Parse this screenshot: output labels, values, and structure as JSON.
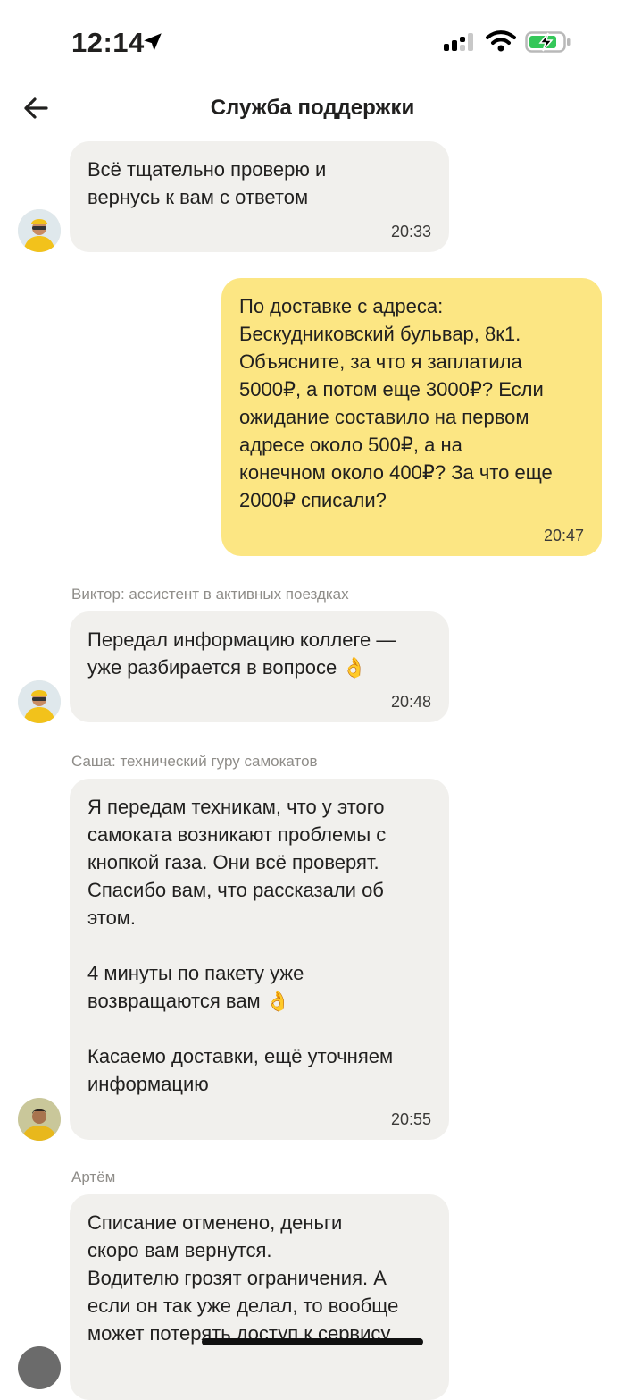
{
  "status_bar": {
    "time": "12:14"
  },
  "header": {
    "title": "Служба поддержки"
  },
  "messages": [
    {
      "text": "Всё тщательно проверю и\nвернусь к вам с ответом",
      "time": "20:33"
    },
    {
      "text": "По доставке с адреса:\nБескудниковский бульвар, 8к1.\nОбъясните, за что я заплатила\n5000₽, а потом еще 3000₽? Если\nожидание составило на первом\nадресе около 500₽, а на\nконечном около 400₽? За что еще\n2000₽ списали?",
      "time": "20:47"
    },
    {
      "sender": "Виктор: ассистент в активных поездках",
      "text": "Передал информацию коллеге —\nуже разбирается в вопросе 👌",
      "time": "20:48"
    },
    {
      "sender": "Саша: технический гуру самокатов",
      "text": "Я передам техникам, что у этого\nсамоката возникают проблемы с\nкнопкой газа. Они всё проверят.\nСпасибо вам, что рассказали об\nэтом.\n\n4 минуты по пакету уже\nвозвращаются вам 👌\n\nКасаемо доставки, ещё уточняем\nинформацию",
      "time": "20:55"
    },
    {
      "sender": "Артём",
      "text": "Списание отменено, деньги\nскоро вам вернутся.\nВодителю грозят ограничения. А\nесли он так уже делал, то вообще\nможет потерять доступ к сервису"
    }
  ],
  "colors": {
    "incoming_bubble": "#f1f0ed",
    "outgoing_bubble": "#fce683",
    "text": "#21201f",
    "sender_label": "#8f8d89"
  },
  "icons": [
    "location-arrow-icon",
    "cellular-signal-icon",
    "wifi-icon",
    "battery-charging-icon",
    "back-arrow-icon",
    "courier-avatar-icon",
    "support-agent-avatar-icon"
  ]
}
